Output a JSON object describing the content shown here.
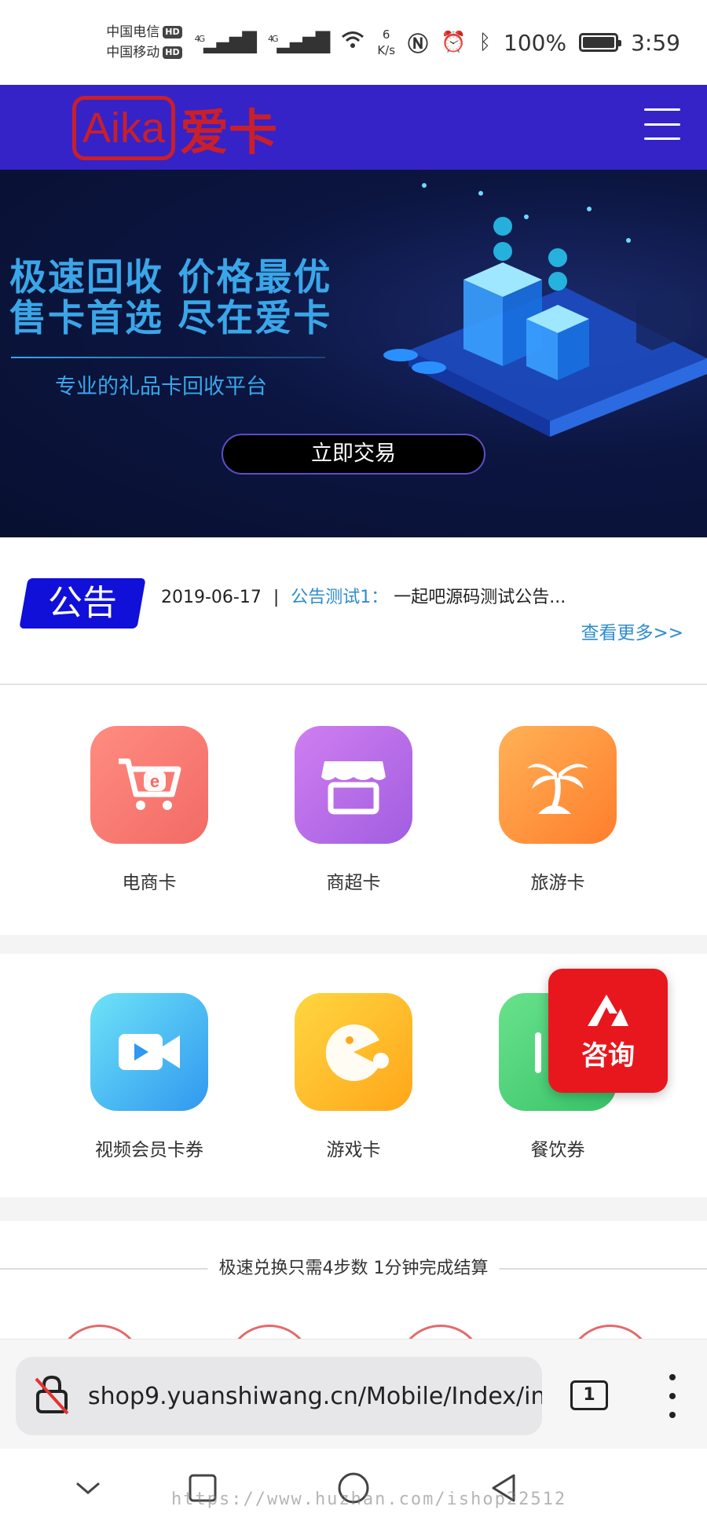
{
  "status_bar": {
    "carrier1": "中国电信",
    "carrier2": "中国移动",
    "hd": "HD",
    "net_type": "4G",
    "speed_value": "6",
    "speed_unit": "K/s",
    "battery": "100%",
    "time": "3:59"
  },
  "header": {
    "logo_en": "Aika",
    "logo_cn": "爱卡"
  },
  "banner": {
    "title_line1": "极速回收  价格最优",
    "title_line2": "售卡首选  尽在爱卡",
    "subtitle": "专业的礼品卡回收平台",
    "cta": "立即交易"
  },
  "notice": {
    "badge": "公告",
    "date": "2019-06-17",
    "separator": "|",
    "title": "公告测试1：",
    "content": "一起吧源码测试公告...",
    "more": "查看更多>>"
  },
  "categories_row1": [
    {
      "label": "电商卡",
      "icon": "shopping-cart-icon",
      "color": "#f26b66"
    },
    {
      "label": "商超卡",
      "icon": "storefront-icon",
      "color": "#a15ee0"
    },
    {
      "label": "旅游卡",
      "icon": "palm-tree-icon",
      "color": "#ff7e2c"
    }
  ],
  "categories_row2": [
    {
      "label": "视频会员卡券",
      "icon": "video-camera-icon",
      "color": "#3098f0"
    },
    {
      "label": "游戏卡",
      "icon": "pacman-icon",
      "color": "#ffa61a"
    },
    {
      "label": "餐饮券",
      "icon": "food-icon",
      "color": "#37c268"
    }
  ],
  "consult": {
    "label": "咨询",
    "icon": "consult-logo-icon"
  },
  "steps": {
    "title": "极速兑换只需4步数   1分钟完成结算"
  },
  "browser": {
    "url": "shop9.yuanshiwang.cn/Mobile/Index/in",
    "tab_count": "1"
  },
  "watermark": "https://www.huzhan.com/ishop22512"
}
